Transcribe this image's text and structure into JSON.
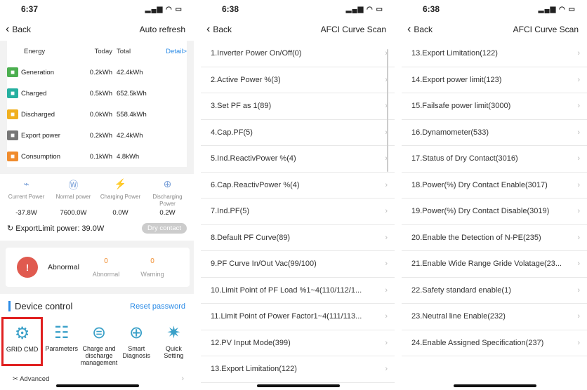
{
  "panel1": {
    "time": "6:37",
    "signal": "📶 ⌔ ▬",
    "back": "Back",
    "nav_right": "Auto refresh",
    "energy_header": {
      "energy": "Energy",
      "today": "Today",
      "total": "Total",
      "detail": "Detail>"
    },
    "energy_rows": [
      {
        "label": "Generation",
        "today": "0.2kWh",
        "total": "42.4kWh",
        "color": "#4caf50"
      },
      {
        "label": "Charged",
        "today": "0.5kWh",
        "total": "652.5kWh",
        "color": "#26b0a0"
      },
      {
        "label": "Discharged",
        "today": "0.0kWh",
        "total": "558.4kWh",
        "color": "#f0b020"
      },
      {
        "label": "Export power",
        "today": "0.2kWh",
        "total": "42.4kWh",
        "color": "#777777"
      },
      {
        "label": "Consumption",
        "today": "0.1kWh",
        "total": "4.8kWh",
        "color": "#f08c2e"
      }
    ],
    "power_labels": [
      "Current Power",
      "Normal power",
      "Charging Power",
      "Discharging Power"
    ],
    "power_values": [
      "-37.8W",
      "7600.0W",
      "0.0W",
      "0.2W"
    ],
    "export_limit": "ExportLimit power: 39.0W",
    "dry_contact": "Dry contact",
    "alarm": {
      "text": "Abnormal",
      "abnormal_count": "0",
      "abnormal_label": "Abnormal",
      "warning_count": "0",
      "warning_label": "Warning"
    },
    "device_control": "Device control",
    "reset_password": "Reset password",
    "tools": [
      "GRID CMD",
      "Parameters",
      "Charge and discharge management",
      "Smart Diagnosis",
      "Quick Setting"
    ],
    "advanced": "Advanced"
  },
  "panel2": {
    "time": "6:38",
    "back": "Back",
    "title": "AFCI Curve Scan",
    "items": [
      "1.Inverter Power On/Off(0)",
      "2.Active Power %(3)",
      "3.Set PF as 1(89)",
      "4.Cap.PF(5)",
      "5.Ind.ReactivPower %(4)",
      "6.Cap.ReactivPower %(4)",
      "7.Ind.PF(5)",
      "8.Default PF Curve(89)",
      "9.PF Curve In/Out Vac(99/100)",
      "10.Limit Point of PF Load %1~4(110/112/1...",
      "11.Limit Point of Power Factor1~4(111/113...",
      "12.PV Input Mode(399)",
      "13.Export Limitation(122)"
    ]
  },
  "panel3": {
    "time": "6:38",
    "back": "Back",
    "title": "AFCI Curve Scan",
    "items": [
      "13.Export Limitation(122)",
      "14.Export power limit(123)",
      "15.Failsafe power limit(3000)",
      "16.Dynamometer(533)",
      "17.Status of Dry Contact(3016)",
      "18.Power(%) Dry Contact Enable(3017)",
      "19.Power(%) Dry Contact Disable(3019)",
      "20.Enable the Detection of N-PE(235)",
      "21.Enable Wide Range Gride Volatage(23...",
      "22.Safety standard enable(1)",
      "23.Neutral line Enable(232)",
      "24.Enable Assigned Specification(237)"
    ]
  }
}
